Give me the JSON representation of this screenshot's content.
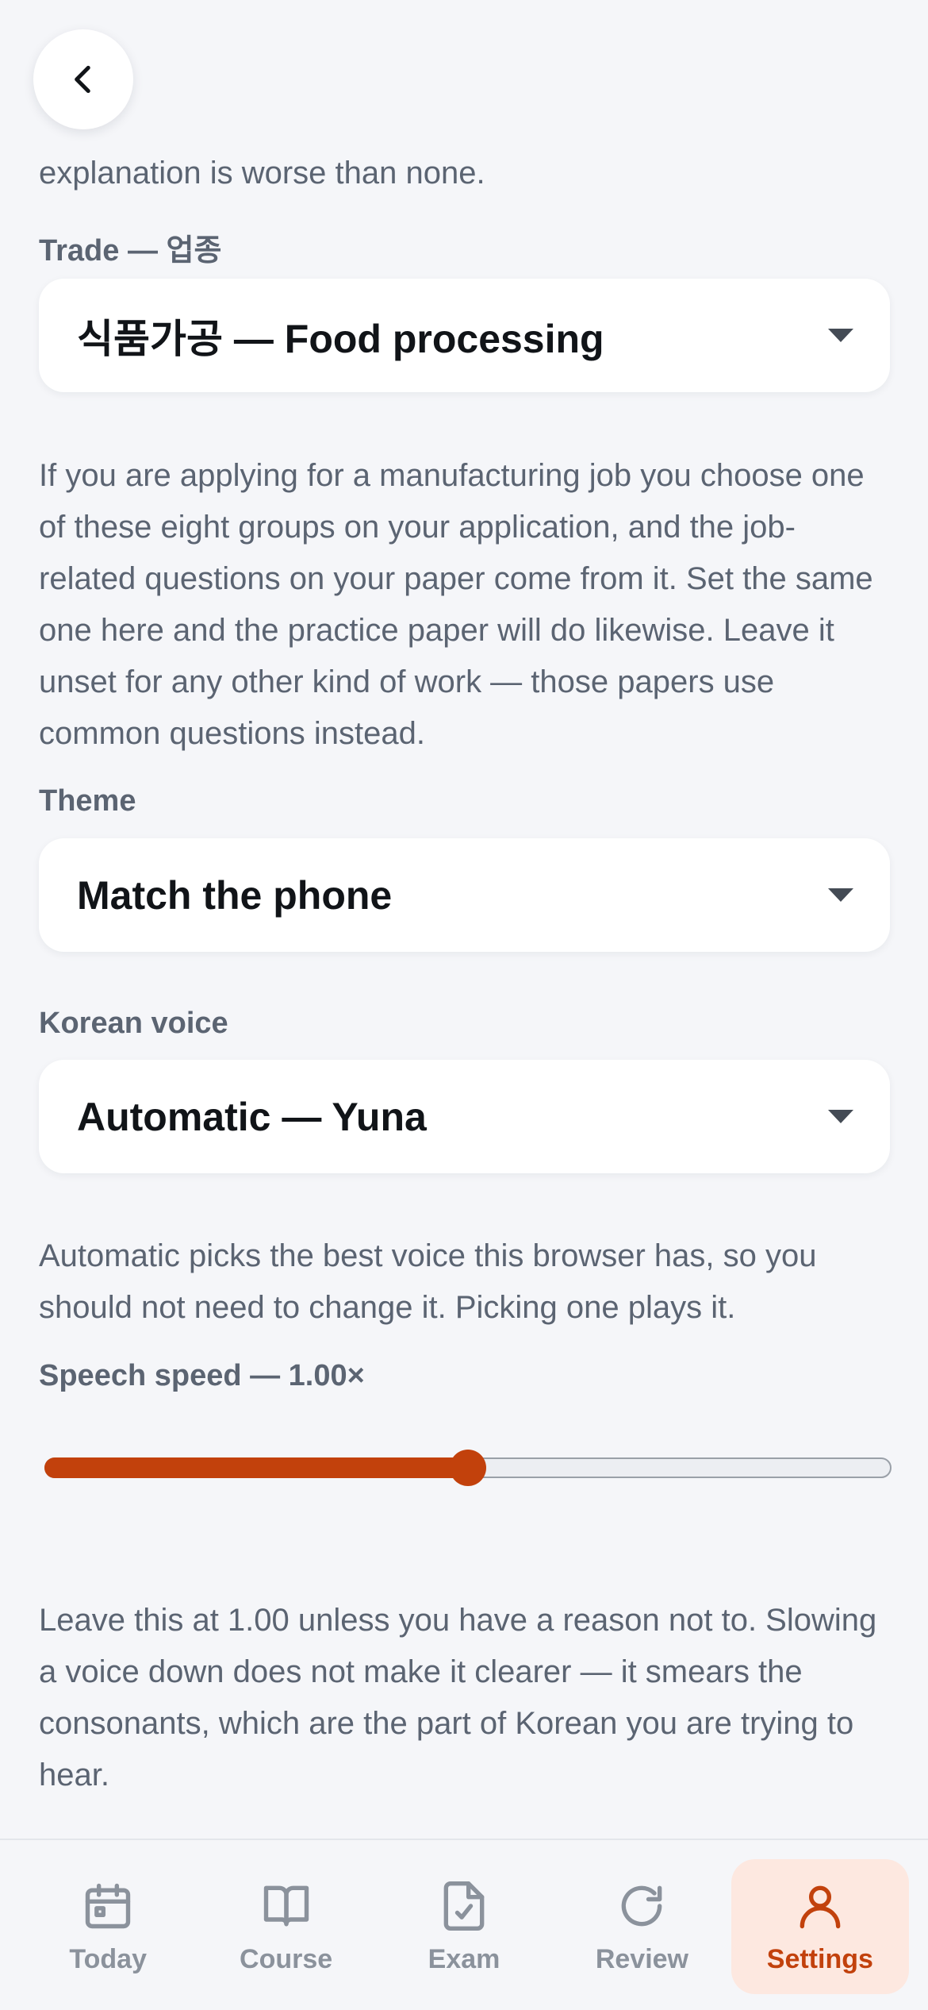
{
  "back_button": {
    "icon": "chevron-left-icon"
  },
  "intro_tail": "explanation is worse than none.",
  "trade": {
    "label": "Trade — 업종",
    "selected": "식품가공 — Food processing",
    "help": "If you are applying for a manufacturing job you choose one of these eight groups on your application, and the job-related questions on your paper come from it. Set the same one here and the practice paper will do likewise. Leave it unset for any other kind of work — those papers use common questions instead."
  },
  "theme": {
    "label": "Theme",
    "selected": "Match the phone"
  },
  "voice": {
    "label": "Korean voice",
    "selected": "Automatic — Yuna",
    "help": "Automatic picks the best voice this browser has, so you should not need to change it. Picking one plays it."
  },
  "speed": {
    "label": "Speech speed — 1.00×",
    "value": 1.0,
    "min": 0.5,
    "max": 1.5,
    "help": "Leave this at 1.00 unless you have a reason not to. Slowing a voice down does not make it clearer — it smears the consonants, which are the part of Korean you are trying to hear."
  },
  "colors": {
    "accent": "#c2410c",
    "accent_soft": "#fde8e0",
    "inactive": "#8b929c"
  },
  "tabs": [
    {
      "label": "Today",
      "icon": "calendar-icon",
      "active": false
    },
    {
      "label": "Course",
      "icon": "book-icon",
      "active": false
    },
    {
      "label": "Exam",
      "icon": "checked-document-icon",
      "active": false
    },
    {
      "label": "Review",
      "icon": "refresh-icon",
      "active": false
    },
    {
      "label": "Settings",
      "icon": "person-icon",
      "active": true
    }
  ]
}
